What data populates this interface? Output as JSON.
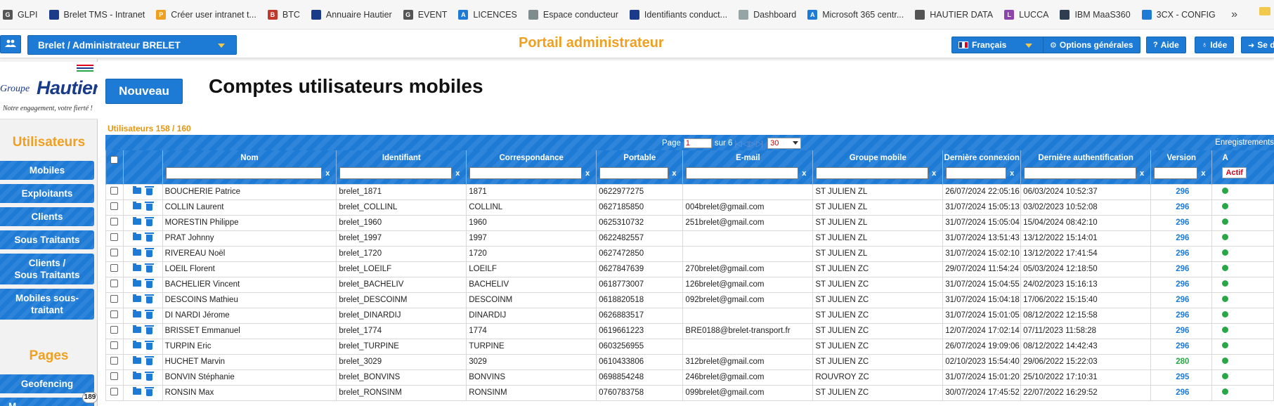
{
  "bookmarks": [
    {
      "label": "GLPI",
      "icon": "glpi-icon",
      "color": "#555555",
      "glyph": "G"
    },
    {
      "label": "Brelet TMS - Intranet",
      "icon": "tms-icon",
      "color": "#1a3a8a",
      "glyph": ""
    },
    {
      "label": "Créer user intranet t...",
      "icon": "pma-icon",
      "color": "#f0a020",
      "glyph": "P"
    },
    {
      "label": "BTC",
      "icon": "btc-icon",
      "color": "#c0392b",
      "glyph": "B"
    },
    {
      "label": "Annuaire Hautier",
      "icon": "annuaire-icon",
      "color": "#1a3a8a",
      "glyph": ""
    },
    {
      "label": "EVENT",
      "icon": "event-icon",
      "color": "#555555",
      "glyph": "G"
    },
    {
      "label": "LICENCES",
      "icon": "licences-icon",
      "color": "#1d7bd6",
      "glyph": "A"
    },
    {
      "label": "Espace conducteur",
      "icon": "truck-icon",
      "color": "#7f8c8d",
      "glyph": ""
    },
    {
      "label": "Identifiants conduct...",
      "icon": "identifiants-icon",
      "color": "#1a3a8a",
      "glyph": ""
    },
    {
      "label": "Dashboard",
      "icon": "dashboard-icon",
      "color": "#95a5a6",
      "glyph": ""
    },
    {
      "label": "Microsoft 365 centr...",
      "icon": "microsoft-icon",
      "color": "#1d7bd6",
      "glyph": "A"
    },
    {
      "label": "HAUTIER DATA",
      "icon": "globe-icon",
      "color": "#555555",
      "glyph": ""
    },
    {
      "label": "LUCCA",
      "icon": "lucca-icon",
      "color": "#8e44ad",
      "glyph": "L"
    },
    {
      "label": "IBM MaaS360",
      "icon": "ibm-icon",
      "color": "#2c3e50",
      "glyph": ""
    },
    {
      "label": "3CX - CONFIG",
      "icon": "3cx-icon",
      "color": "#1d7bd6",
      "glyph": ""
    }
  ],
  "bookmarks_more": "»",
  "topbar": {
    "account": "Brelet / Administrateur BRELET",
    "portal_title": "Portail administrateur",
    "language": "Français",
    "options": "Options générales",
    "help": "Aide",
    "idea": "Idée",
    "logout": "Se d"
  },
  "sidebar": {
    "logo_groupe": "Groupe",
    "logo_name": "Hautier",
    "logo_slogan": "Notre engagement, votre fierté !",
    "section_users": "Utilisateurs",
    "items": [
      "Mobiles",
      "Exploitants",
      "Clients",
      "Sous Traitants",
      "Clients /\nSous Traitants",
      "Mobiles sous-\ntraitant"
    ],
    "section_pages": "Pages",
    "pages_items": [
      "Geofencing",
      "M"
    ],
    "badge": "189"
  },
  "main": {
    "new_button": "Nouveau",
    "title": "Comptes utilisateurs mobiles",
    "count_label": "Utilisateurs 158 / 160"
  },
  "pager": {
    "page_label": "Page",
    "page_value": "1",
    "of_label": "sur 6",
    "nav": "|◁ ◁ ▷ ▷|",
    "per_page": "30",
    "records_label": "Enregistrements"
  },
  "columns": [
    "Nom",
    "Identifiant",
    "Correspondance",
    "Portable",
    "E-mail",
    "Groupe mobile",
    "Dernière connexion",
    "Dernière authentification",
    "Version",
    "A"
  ],
  "status_filter": "Actif",
  "rows": [
    [
      "BOUCHERIE Patrice",
      "brelet_1871",
      "1871",
      "0622977275",
      "",
      "ST JULIEN ZL",
      "26/07/2024 22:05:16",
      "06/03/2024 10:52:37",
      "296"
    ],
    [
      "COLLIN Laurent",
      "brelet_COLLINL",
      "COLLINL",
      "0627185850",
      "004brelet@gmail.com",
      "ST JULIEN ZL",
      "31/07/2024 15:05:13",
      "03/02/2023 10:52:08",
      "296"
    ],
    [
      "MORESTIN Philippe",
      "brelet_1960",
      "1960",
      "0625310732",
      "251brelet@gmail.com",
      "ST JULIEN ZL",
      "31/07/2024 15:05:04",
      "15/04/2024 08:42:10",
      "296"
    ],
    [
      "PRAT Johnny",
      "brelet_1997",
      "1997",
      "0622482557",
      "",
      "ST JULIEN ZL",
      "31/07/2024 13:51:43",
      "13/12/2022 15:14:01",
      "296"
    ],
    [
      "RIVEREAU Noël",
      "brelet_1720",
      "1720",
      "0627472850",
      "",
      "ST JULIEN ZL",
      "31/07/2024 15:02:10",
      "13/12/2022 17:41:54",
      "296"
    ],
    [
      "LOEIL Florent",
      "brelet_LOEILF",
      "LOEILF",
      "0627847639",
      "270brelet@gmail.com",
      "ST JULIEN ZC",
      "29/07/2024 11:54:24",
      "05/03/2024 12:18:50",
      "296"
    ],
    [
      "BACHELIER Vincent",
      "brelet_BACHELIV",
      "BACHELIV",
      "0618773007",
      "126brelet@gmail.com",
      "ST JULIEN ZC",
      "31/07/2024 15:04:55",
      "24/02/2023 15:16:13",
      "296"
    ],
    [
      "DESCOINS Mathieu",
      "brelet_DESCOINM",
      "DESCOINM",
      "0618820518",
      "092brelet@gmail.com",
      "ST JULIEN ZC",
      "31/07/2024 15:04:18",
      "17/06/2022 15:15:40",
      "296"
    ],
    [
      "DI NARDI Jérome",
      "brelet_DINARDIJ",
      "DINARDIJ",
      "0626883517",
      "",
      "ST JULIEN ZC",
      "31/07/2024 15:01:05",
      "08/12/2022 12:15:58",
      "296"
    ],
    [
      "BRISSET Emmanuel",
      "brelet_1774",
      "1774",
      "0619661223",
      "BRE0188@brelet-transport.fr",
      "ST JULIEN ZC",
      "12/07/2024 17:02:14",
      "07/11/2023 11:58:28",
      "296"
    ],
    [
      "TURPIN Eric",
      "brelet_TURPINE",
      "TURPINE",
      "0603256955",
      "",
      "ST JULIEN ZC",
      "26/07/2024 19:09:06",
      "08/12/2022 14:42:43",
      "296"
    ],
    [
      "HUCHET Marvin",
      "brelet_3029",
      "3029",
      "0610433806",
      "312brelet@gmail.com",
      "ST JULIEN ZC",
      "02/10/2023 15:54:40",
      "29/06/2022 15:22:03",
      "280"
    ],
    [
      "BONVIN Stéphanie",
      "brelet_BONVINS",
      "BONVINS",
      "0698854248",
      "246brelet@gmail.com",
      "ROUVROY ZC",
      "31/07/2024 15:01:20",
      "25/10/2022 17:10:31",
      "295"
    ],
    [
      "RONSIN Max",
      "brelet_RONSINM",
      "RONSINM",
      "0760783758",
      "099brelet@gmail.com",
      "ST JULIEN ZC",
      "30/07/2024 17:45:52",
      "22/07/2022 16:29:52",
      "296"
    ]
  ],
  "colors": {
    "accent": "#1d7bd6",
    "orange": "#f0a020",
    "green": "#28a745",
    "red": "#e0001b"
  }
}
